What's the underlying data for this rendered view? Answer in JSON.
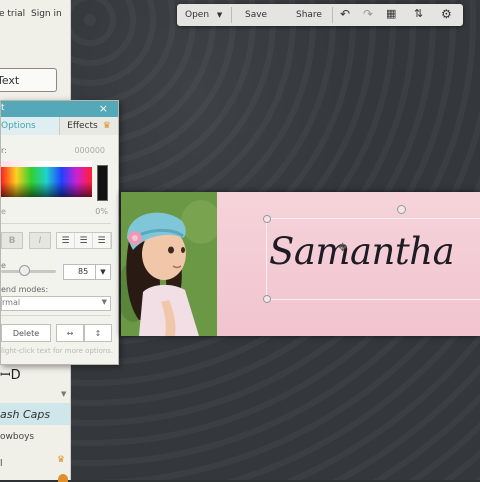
{
  "header": {
    "free_trial": "e trial",
    "sign_in": "Sign in"
  },
  "sidebar": {
    "text_button": "Text",
    "font_selected": "ash Caps",
    "font_next": "owboys"
  },
  "toolbar": {
    "open": "Open",
    "save": "Save",
    "share": "Share",
    "icons": [
      "undo-icon",
      "redo-icon",
      "resize-icon",
      "layers-icon",
      "gear-icon"
    ]
  },
  "panel": {
    "title": "t",
    "close": "×",
    "tab_options": "Options",
    "tab_effects": "Effects",
    "color_label": "r:",
    "color_value": "000000",
    "opacity_label": "e",
    "opacity_value": "0%",
    "bold": "B",
    "italic": "I",
    "size_label": "e",
    "size_value": "85",
    "blend_label": "end modes:",
    "blend_value": "rmal",
    "delete": "Delete",
    "flip_h": "↔",
    "flip_v": "↕",
    "hint": "light-click text for more options."
  },
  "canvas": {
    "text": "Samantha"
  },
  "colors": {
    "accent": "#54a8b8",
    "premium": "#e0902a",
    "banner_pink": "#f3cbd4"
  }
}
